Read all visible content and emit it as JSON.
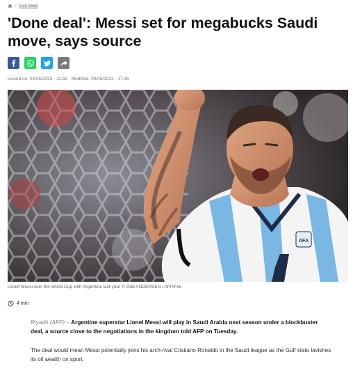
{
  "breadcrumb": {
    "separator": "/",
    "section": "Live news"
  },
  "article": {
    "headline": "'Done deal': Messi set for megabucks Saudi move, says source",
    "issued": "Issued on: 09/05/2023 - 11:58",
    "modified": "Modified: 09/05/2023 - 17:36",
    "caption": "Lionel Messi won the World Cup with Argentina last year © Odd ANDERSEN / AFP/File",
    "read_time": "4 min",
    "dateline": "Riyadh (AFP)",
    "dateline_sep": "–",
    "lead": "Argentine superstar Lionel Messi will play in Saudi Arabia next season under a blockbuster deal, a source close to the negotiations in the kingdom told AFP on Tuesday.",
    "paragraph_1": "The deal would mean Messi potentially joins his arch-rival Cristiano Ronaldo in the Saudi league as the Gulf state lavishes its oil wealth on sport.",
    "jersey_badge": "AFA"
  },
  "share": {
    "icons": [
      "facebook-icon",
      "whatsapp-icon",
      "twitter-icon",
      "share-icon"
    ],
    "colors": {
      "facebook": "#3b5998",
      "whatsapp": "#25d366",
      "twitter": "#1da1f2",
      "share": "#7b7b7b"
    }
  }
}
